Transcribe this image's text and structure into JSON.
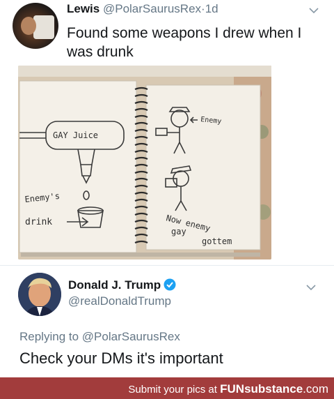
{
  "tweet1": {
    "display_name": "Lewis",
    "handle": "@PolarSaurusRex",
    "separator": "·",
    "time": "1d",
    "text": "Found some weapons I drew when I was drunk",
    "drawing": {
      "label_juice": "GAY Juice",
      "label_enemy": "Enemy",
      "label_enemys": "Enemy's",
      "label_drink": "drink",
      "label_now": "Now enemy",
      "label_gay": "gay",
      "label_gottem": "gottem"
    }
  },
  "tweet2": {
    "display_name": "Donald J. Trump",
    "handle": "@realDonaldTrump",
    "replying_prefix": "Replying to",
    "replying_to": "@PolarSaurusRex",
    "text": "Check your DMs it's important"
  },
  "footer": {
    "prefix": "Submit your pics at",
    "brand_bold": "FUN",
    "brand_rest": "substance",
    "brand_tld": ".com"
  },
  "colors": {
    "handle": "#657786",
    "footer_bg": "#a23c3c",
    "verified": "#1da1f2"
  },
  "icons": [
    "chevron-down-icon",
    "verified-badge-icon"
  ]
}
